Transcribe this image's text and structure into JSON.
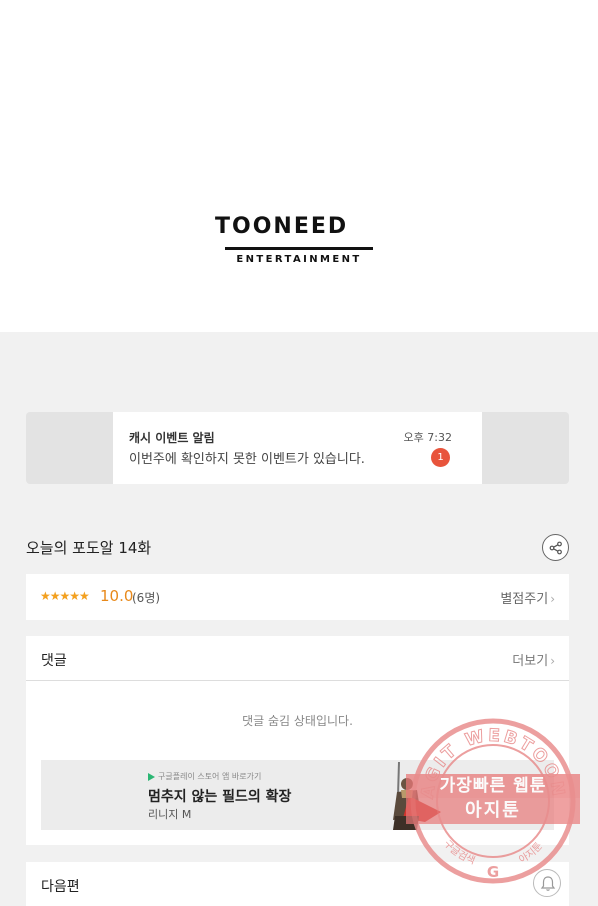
{
  "logo": {
    "title": "TOONEED",
    "subtitle": "ENTERTAINMENT"
  },
  "banner": {
    "title": "캐시 이벤트 알림",
    "time": "오후 7:32",
    "message": "이번주에 확인하지 못한 이벤트가 있습니다.",
    "badge_count": "1"
  },
  "episode": {
    "title": "오늘의 포도알 14화",
    "share_icon": "share-icon"
  },
  "rating": {
    "stars": "★★★★★",
    "score": "10.0",
    "count": "(6명)",
    "rate_label": "별점주기"
  },
  "comments": {
    "title": "댓글",
    "more_label": "더보기",
    "hidden_message": "댓글 숨김 상태입니다."
  },
  "ad": {
    "store_label": "구글플레이 스토어 앱 바로가기",
    "headline": "멈추지 않는 필드의 확장",
    "subtitle": "리니지 M"
  },
  "next": {
    "title": "다음편"
  },
  "watermark": {
    "arc_text": "AGIT WEBTOON",
    "line1": "가장빠른 웹툰",
    "line2": "아지툰",
    "bottom_left": "구글검색",
    "bottom_right": "아지툰"
  },
  "colors": {
    "accent": "#e8891a",
    "badge": "#e8543c",
    "watermark": "#e87878"
  }
}
